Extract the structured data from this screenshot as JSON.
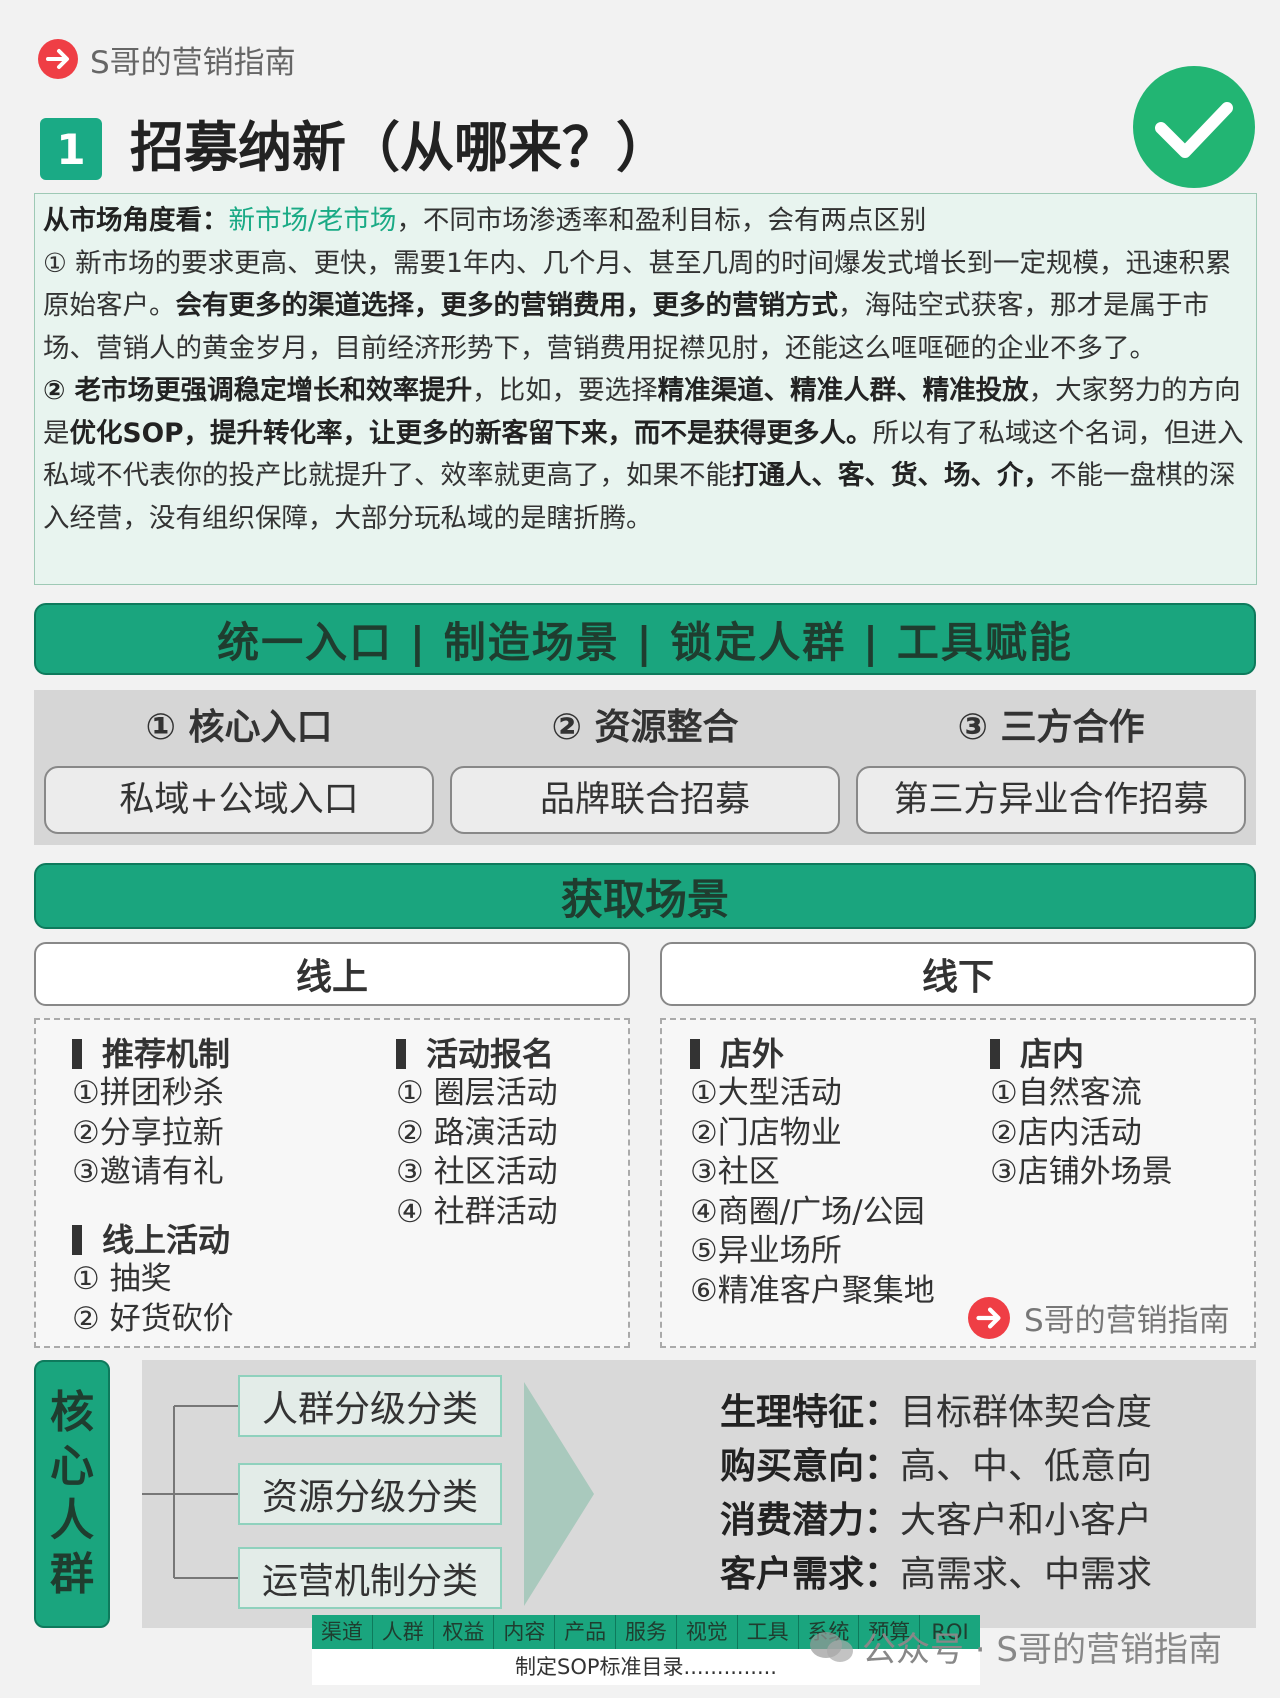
{
  "brand": {
    "name": "S哥的营销指南"
  },
  "title": {
    "number": "1",
    "text": "招募纳新（从哪来？）"
  },
  "intro": {
    "line1_bold": "从市场角度看：",
    "line1_teal": "新市场/老市场",
    "line1_rest": "，不同市场渗透率和盈利目标，会有两点区别",
    "p1_a": "① 新市场的要求更高、更快，需要1年内、几个月、甚至几周的时间爆发式增长到一定规模，迅速积累原始客户。",
    "p1_b": "会有更多的渠道选择，更多的营销费用，更多的营销方式",
    "p1_c": "，海陆空式获客，那才是属于市场、营销人的黄金岁月，目前经济形势下，营销费用捉襟见肘，还能这么哐哐砸的企业不多了。",
    "p2_a": "② 老市场更强调稳定增长和效率提升",
    "p2_b": "，比如，要选择",
    "p2_c": "精准渠道、精准人群、精准投放",
    "p2_d": "，大家努力的方向是",
    "p2_e": "优化SOP，提升转化率，让更多的新客留下来，而不是获得更多人。",
    "p2_f": "所以有了私域这个名词，但进入私域不代表你的投产比就提升了、效率就更高了，如果不能",
    "p2_g": "打通人、客、货、场、介，",
    "p2_h": "不能一盘棋的深入经营，没有组织保障，大部分玩私域的是瞎折腾。"
  },
  "banner": {
    "text": "统一入口 | 制造场景 | 锁定人群 | 工具赋能"
  },
  "resources": [
    {
      "head": "① 核心入口",
      "box": "私域+公域入口"
    },
    {
      "head": "② 资源整合",
      "box": "品牌联合招募"
    },
    {
      "head": "③ 三方合作",
      "box": "第三方异业合作招募"
    }
  ],
  "scene": {
    "title": "获取场景",
    "online_tab": "线上",
    "offline_tab": "线下",
    "online": {
      "g1": {
        "title": "推荐机制",
        "items": [
          "①拼团秒杀",
          "②分享拉新",
          "③邀请有礼"
        ]
      },
      "g2": {
        "title": "活动报名",
        "items": [
          "① 圈层活动",
          "② 路演活动",
          "③ 社区活动",
          "④ 社群活动"
        ]
      },
      "g3": {
        "title": "线上活动",
        "items": [
          "① 抽奖",
          "② 好货砍价"
        ]
      }
    },
    "offline": {
      "g1": {
        "title": "店外",
        "items": [
          "①大型活动",
          "②门店物业",
          "③社区",
          "④商圈/广场/公园",
          "⑤异业场所",
          "⑥精准客户聚集地"
        ]
      },
      "g2": {
        "title": "店内",
        "items": [
          "①自然客流",
          "②店内活动",
          "③店铺外场景"
        ]
      }
    }
  },
  "core": {
    "label_chars": [
      "核",
      "心",
      "人",
      "群"
    ],
    "classes": [
      "人群分级分类",
      "资源分级分类",
      "运营机制分类"
    ],
    "features": [
      {
        "k": "生理特征：",
        "v": "目标群体契合度"
      },
      {
        "k": "购买意向：",
        "v": "高、中、低意向"
      },
      {
        "k": "消费潜力：",
        "v": "大客户和小客户"
      },
      {
        "k": "客户需求：",
        "v": "高需求、中需求"
      }
    ]
  },
  "footer": {
    "categories": [
      "渠道",
      "人群",
      "权益",
      "内容",
      "产品",
      "服务",
      "视觉",
      "工具",
      "系统",
      "预算",
      "ROI"
    ],
    "sop": "制定SOP标准目录..............",
    "watermark": "公众号 · S哥的营销指南"
  },
  "colors": {
    "accent": "#1aa57e",
    "brand_red": "#ef3e45",
    "check_green": "#22b573"
  }
}
